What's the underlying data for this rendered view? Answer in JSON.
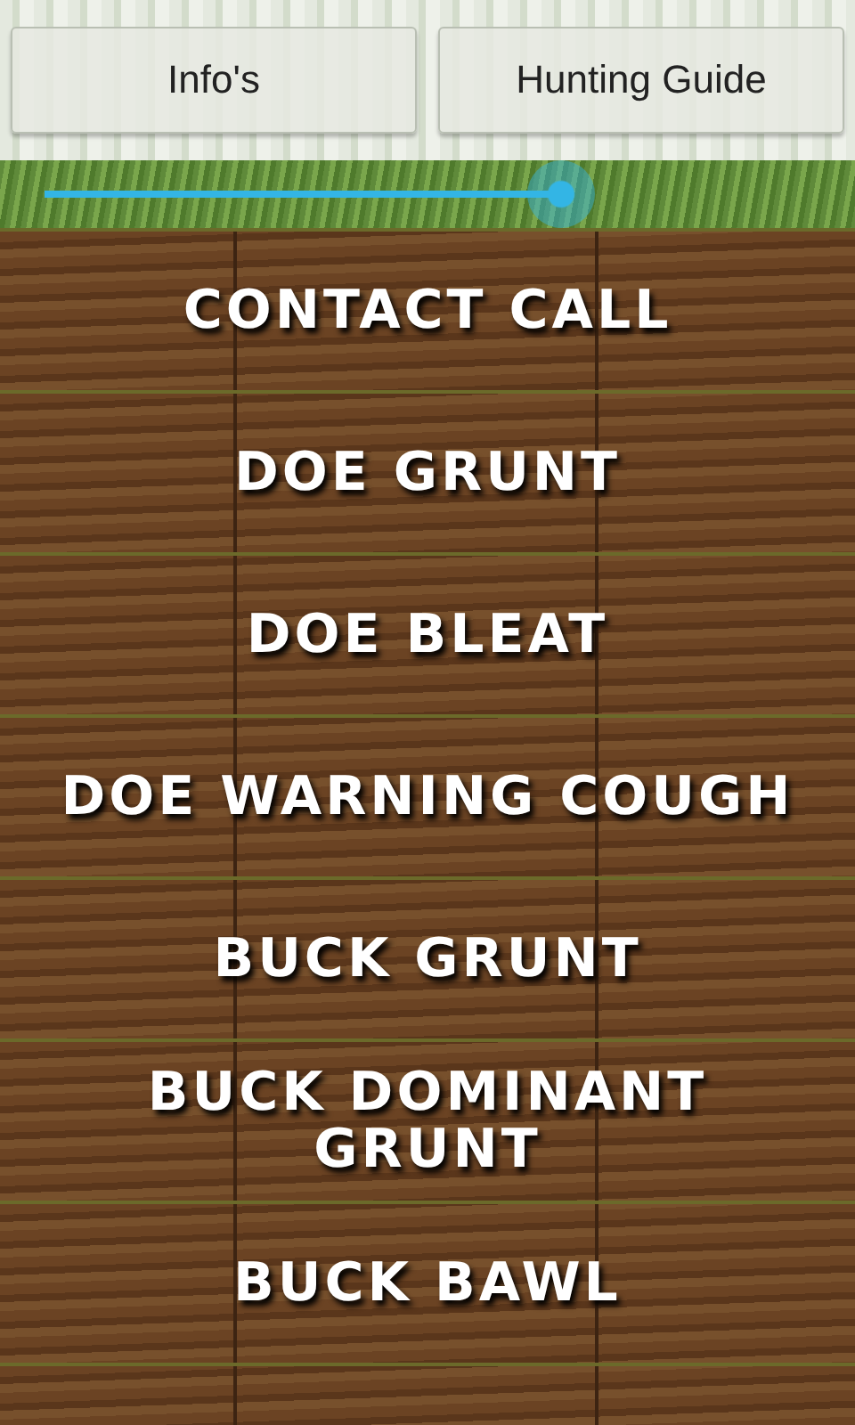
{
  "top_buttons": [
    {
      "label": "Info's"
    },
    {
      "label": "Hunting Guide"
    }
  ],
  "volume": {
    "level": 0.67
  },
  "calls": [
    {
      "label": "CONTACT CALL"
    },
    {
      "label": "DOE GRUNT"
    },
    {
      "label": "DOE BLEAT"
    },
    {
      "label": "DOE WARNING COUGH"
    },
    {
      "label": "BUCK GRUNT"
    },
    {
      "label": "BUCK DOMINANT GRUNT"
    },
    {
      "label": "BUCK BAWL"
    }
  ]
}
